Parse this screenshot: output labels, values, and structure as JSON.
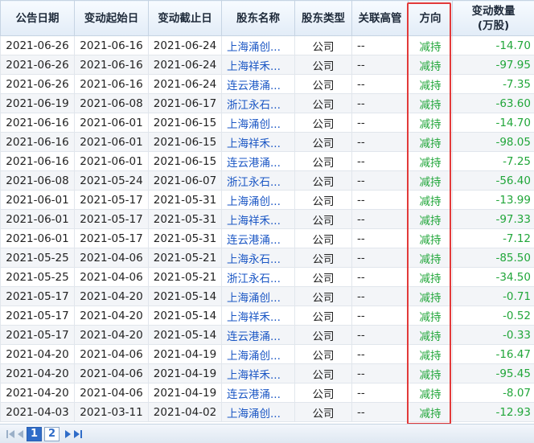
{
  "table": {
    "headers": [
      {
        "label": "公告日期"
      },
      {
        "label": "变动起始日"
      },
      {
        "label": "变动截止日"
      },
      {
        "label": "股东名称"
      },
      {
        "label": "股东类型"
      },
      {
        "label": "关联高管"
      },
      {
        "label": "方向"
      },
      {
        "label": "变动数量",
        "sub": "(万股)"
      }
    ],
    "rows": [
      {
        "announce": "2021-06-26",
        "start": "2021-06-16",
        "end": "2021-06-24",
        "holder": "上海涌创...",
        "type": "公司",
        "related": "--",
        "direction": "减持",
        "amount": "-14.70"
      },
      {
        "announce": "2021-06-26",
        "start": "2021-06-16",
        "end": "2021-06-24",
        "holder": "上海祥禾...",
        "type": "公司",
        "related": "--",
        "direction": "减持",
        "amount": "-97.95"
      },
      {
        "announce": "2021-06-26",
        "start": "2021-06-16",
        "end": "2021-06-24",
        "holder": "连云港涌...",
        "type": "公司",
        "related": "--",
        "direction": "减持",
        "amount": "-7.35"
      },
      {
        "announce": "2021-06-19",
        "start": "2021-06-08",
        "end": "2021-06-17",
        "holder": "浙江永石...",
        "type": "公司",
        "related": "--",
        "direction": "减持",
        "amount": "-63.60"
      },
      {
        "announce": "2021-06-16",
        "start": "2021-06-01",
        "end": "2021-06-15",
        "holder": "上海涌创...",
        "type": "公司",
        "related": "--",
        "direction": "减持",
        "amount": "-14.70"
      },
      {
        "announce": "2021-06-16",
        "start": "2021-06-01",
        "end": "2021-06-15",
        "holder": "上海祥禾...",
        "type": "公司",
        "related": "--",
        "direction": "减持",
        "amount": "-98.05"
      },
      {
        "announce": "2021-06-16",
        "start": "2021-06-01",
        "end": "2021-06-15",
        "holder": "连云港涌...",
        "type": "公司",
        "related": "--",
        "direction": "减持",
        "amount": "-7.25"
      },
      {
        "announce": "2021-06-08",
        "start": "2021-05-24",
        "end": "2021-06-07",
        "holder": "浙江永石...",
        "type": "公司",
        "related": "--",
        "direction": "减持",
        "amount": "-56.40"
      },
      {
        "announce": "2021-06-01",
        "start": "2021-05-17",
        "end": "2021-05-31",
        "holder": "上海涌创...",
        "type": "公司",
        "related": "--",
        "direction": "减持",
        "amount": "-13.99"
      },
      {
        "announce": "2021-06-01",
        "start": "2021-05-17",
        "end": "2021-05-31",
        "holder": "上海祥禾...",
        "type": "公司",
        "related": "--",
        "direction": "减持",
        "amount": "-97.33"
      },
      {
        "announce": "2021-06-01",
        "start": "2021-05-17",
        "end": "2021-05-31",
        "holder": "连云港涌...",
        "type": "公司",
        "related": "--",
        "direction": "减持",
        "amount": "-7.12"
      },
      {
        "announce": "2021-05-25",
        "start": "2021-04-06",
        "end": "2021-05-21",
        "holder": "上海永石...",
        "type": "公司",
        "related": "--",
        "direction": "减持",
        "amount": "-85.50"
      },
      {
        "announce": "2021-05-25",
        "start": "2021-04-06",
        "end": "2021-05-21",
        "holder": "浙江永石...",
        "type": "公司",
        "related": "--",
        "direction": "减持",
        "amount": "-34.50"
      },
      {
        "announce": "2021-05-17",
        "start": "2021-04-20",
        "end": "2021-05-14",
        "holder": "上海涌创...",
        "type": "公司",
        "related": "--",
        "direction": "减持",
        "amount": "-0.71"
      },
      {
        "announce": "2021-05-17",
        "start": "2021-04-20",
        "end": "2021-05-14",
        "holder": "上海祥禾...",
        "type": "公司",
        "related": "--",
        "direction": "减持",
        "amount": "-0.52"
      },
      {
        "announce": "2021-05-17",
        "start": "2021-04-20",
        "end": "2021-05-14",
        "holder": "连云港涌...",
        "type": "公司",
        "related": "--",
        "direction": "减持",
        "amount": "-0.33"
      },
      {
        "announce": "2021-04-20",
        "start": "2021-04-06",
        "end": "2021-04-19",
        "holder": "上海涌创...",
        "type": "公司",
        "related": "--",
        "direction": "减持",
        "amount": "-16.47"
      },
      {
        "announce": "2021-04-20",
        "start": "2021-04-06",
        "end": "2021-04-19",
        "holder": "上海祥禾...",
        "type": "公司",
        "related": "--",
        "direction": "减持",
        "amount": "-95.45"
      },
      {
        "announce": "2021-04-20",
        "start": "2021-04-06",
        "end": "2021-04-19",
        "holder": "连云港涌...",
        "type": "公司",
        "related": "--",
        "direction": "减持",
        "amount": "-8.07"
      },
      {
        "announce": "2021-04-03",
        "start": "2021-03-11",
        "end": "2021-04-02",
        "holder": "上海涌创...",
        "type": "公司",
        "related": "--",
        "direction": "减持",
        "amount": "-12.93"
      }
    ]
  },
  "pager": {
    "pages": [
      "1",
      "2"
    ],
    "current": "1"
  },
  "colors": {
    "holder_link": "#1a56c4",
    "decrease_green": "#21a63a",
    "highlight_red": "#e23a3a",
    "active_page": "#2f6cc8"
  },
  "icons": {
    "first": "first-page-icon",
    "prev": "prev-page-icon",
    "next": "next-page-icon",
    "last": "last-page-icon"
  }
}
